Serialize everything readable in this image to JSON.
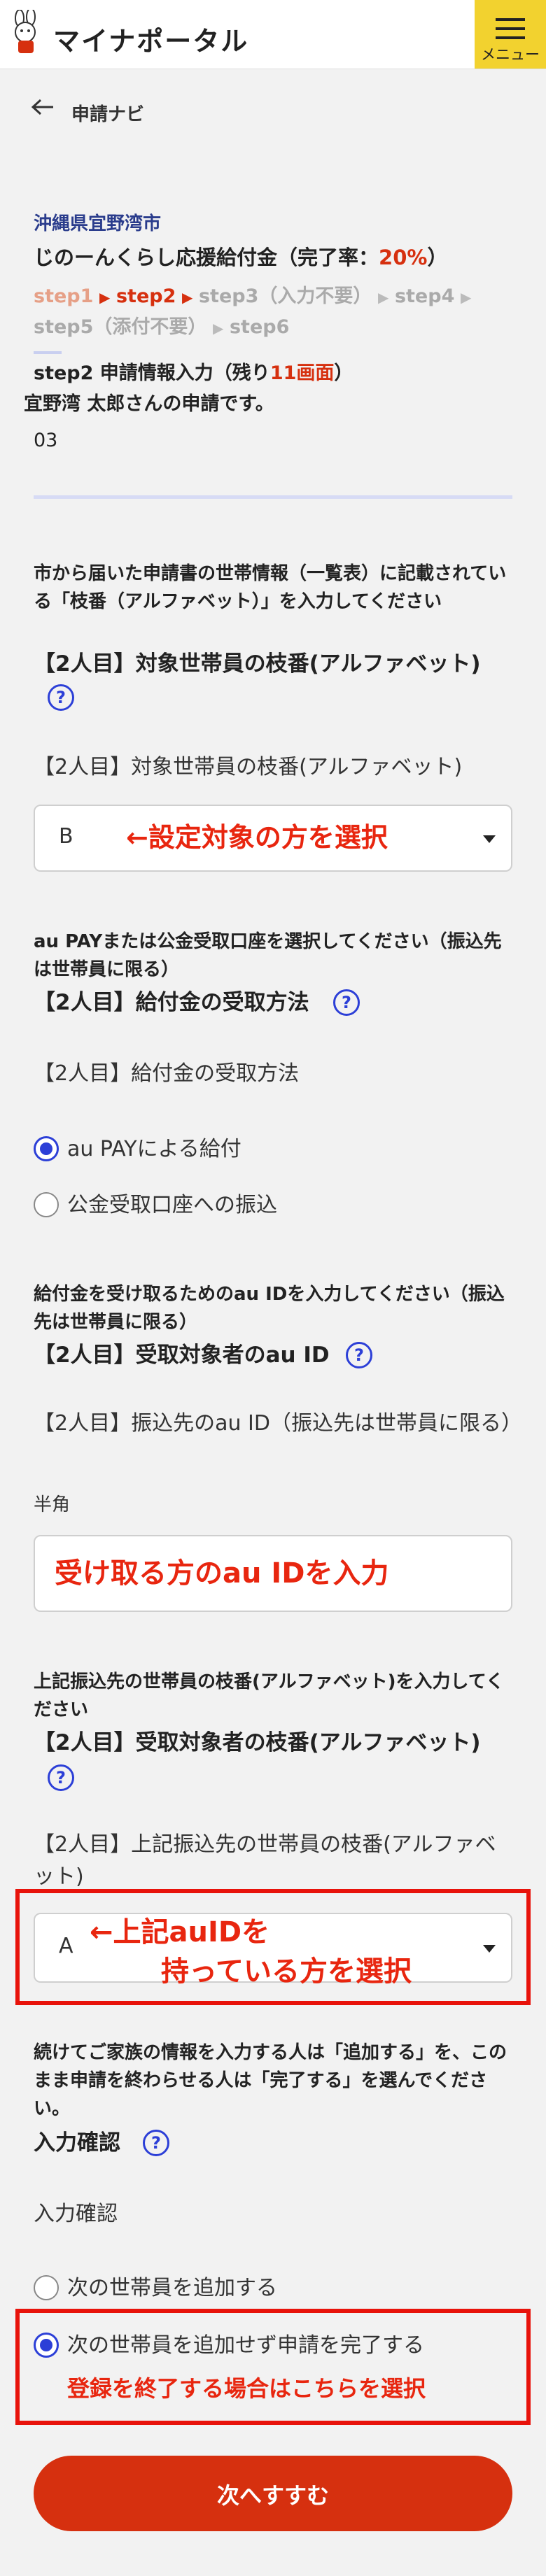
{
  "header": {
    "logo_text": "マイナポータル",
    "menu_label": "メニュー"
  },
  "nav": {
    "back_label": "申請ナビ"
  },
  "application": {
    "municipality": "沖縄県宜野湾市",
    "title_prefix": "じのーんくらし応援給付金（完了率：",
    "completion": "20%",
    "title_suffix": "）"
  },
  "steps": {
    "line1": [
      {
        "label": "step1",
        "state": "done"
      },
      {
        "label": "step2",
        "state": "current"
      },
      {
        "label": "step3（入力不要）",
        "state": "todo"
      },
      {
        "label": "step4",
        "state": "todo"
      }
    ],
    "line2": [
      {
        "label": "step5（添付不要）",
        "state": "todo"
      },
      {
        "label": "step6",
        "state": "todo"
      }
    ],
    "current_prefix": "step2 申請情報入力（残り",
    "remaining": "11画面",
    "current_suffix": "）",
    "applicant_line": "宜野湾 太郎さんの申請です。",
    "count": "03"
  },
  "q1": {
    "instruction": "市から届いた申請書の世帯情報（一覧表）に記載されている「枝番（アルファベット）」を入力してください",
    "title": "【2人目】対象世帯員の枝番(アルファベット)",
    "label": "【2人目】対象世帯員の枝番(アルファベット)",
    "value": "B",
    "annotation": "←設定対象の方を選択"
  },
  "q2": {
    "instruction": "au PAYまたは公金受取口座を選択してください（振込先は世帯員に限る）",
    "title": "【2人目】給付金の受取方法",
    "label": "【2人目】給付金の受取方法",
    "options": [
      "au PAYによる給付",
      "公金受取口座への振込"
    ],
    "selected": 0
  },
  "q3": {
    "instruction": "給付金を受け取るためのau IDを入力してください（振込先は世帯員に限る）",
    "title": "【2人目】受取対象者のau ID",
    "label": "【2人目】振込先のau ID（振込先は世帯員に限る）",
    "hint": "半角",
    "annotation": "受け取る方のau IDを入力"
  },
  "q4": {
    "instruction": "上記振込先の世帯員の枝番(アルファベット)を入力してください",
    "title": "【2人目】受取対象者の枝番(アルファベット)",
    "label": "【2人目】上記振込先の世帯員の枝番(アルファベット)",
    "value": "A",
    "annotation_line1": "←上記auIDを",
    "annotation_line2": "持っている方を選択"
  },
  "q5": {
    "instruction": "続けてご家族の情報を入力する人は「追加する」を、このまま申請を終わらせる人は「完了する」を選んでください。",
    "title": "入力確認",
    "label": "入力確認",
    "options": [
      "次の世帯員を追加する",
      "次の世帯員を追加せず申請を完了する"
    ],
    "selected": 1,
    "annotation": "登録を終了する場合はこちらを選択"
  },
  "next_button": "次へすすむ",
  "colors": {
    "accent": "#2c3fd7",
    "brand_red": "#d6300f",
    "annotation_red": "#e8130b",
    "menu_yellow": "#f2d22f"
  }
}
